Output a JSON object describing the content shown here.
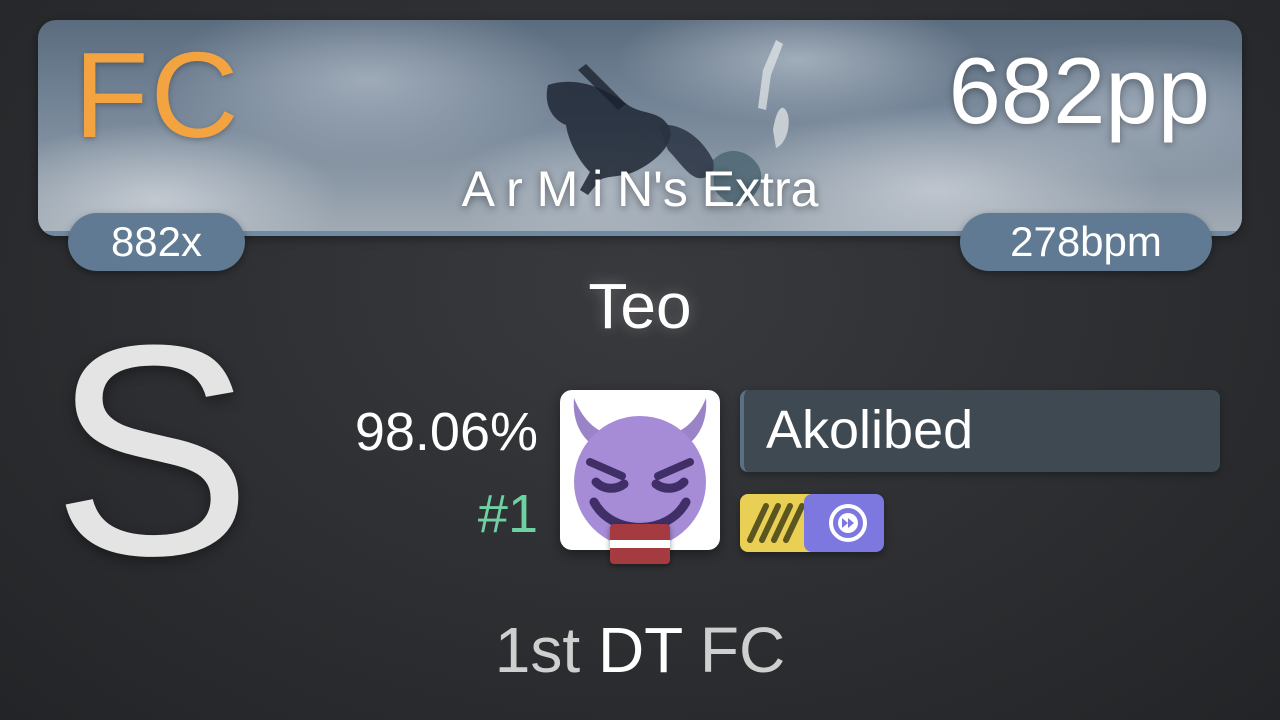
{
  "score": {
    "fc_label": "FC",
    "pp": "682pp",
    "map_title": "A r M i N's Extra",
    "combo": "882x",
    "bpm": "278bpm",
    "mapper": "Teo",
    "grade": "S",
    "accuracy": "98.06%",
    "rank": "#1"
  },
  "player": {
    "name": "Akolibed",
    "avatar": "smiling-devil-emoji",
    "flag": "latvia-flag"
  },
  "mods": [
    {
      "name": "HD",
      "icon": "hidden-mod-icon",
      "color": "#e9d054"
    },
    {
      "name": "DT",
      "icon": "double-time-mod-icon",
      "color": "#7d78e0"
    }
  ],
  "footer": {
    "part1": "1st",
    "part2": "DT",
    "part3": "FC"
  },
  "colors": {
    "fc": "#f3a441",
    "rank": "#6fd1a2",
    "pill": "#5f7a92",
    "player_box": "#3e4952"
  }
}
